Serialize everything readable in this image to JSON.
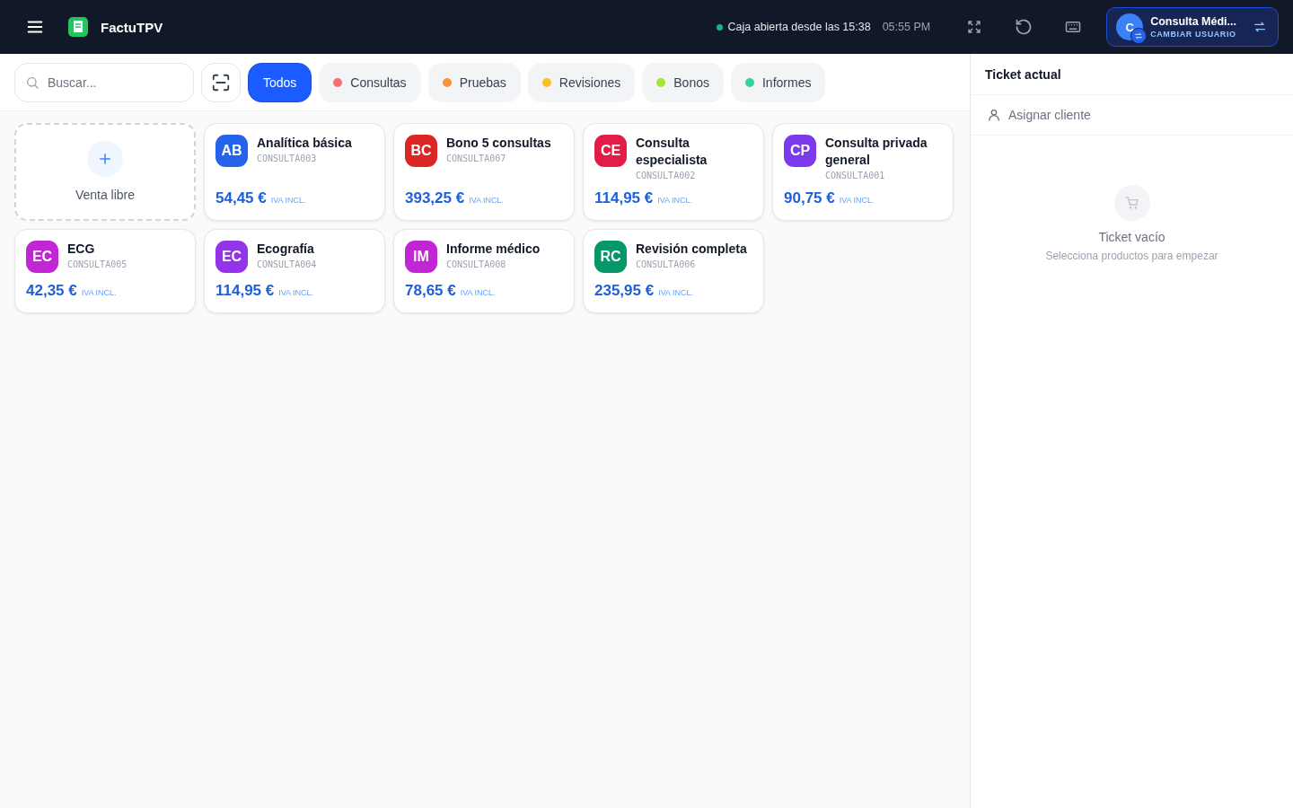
{
  "topbar": {
    "app_name": "FactuTPV",
    "status": {
      "text": "Caja abierta desde las 15:38",
      "color": "#10b981"
    },
    "time": "05:55 PM",
    "user": {
      "initial": "C",
      "name": "Consulta Médi...",
      "action": "CAMBIAR USUARIO"
    }
  },
  "search": {
    "placeholder": "Buscar..."
  },
  "categories": [
    {
      "label": "Todos",
      "selected": true
    },
    {
      "label": "Consultas",
      "selected": false,
      "color": "#f87171"
    },
    {
      "label": "Pruebas",
      "selected": false,
      "color": "#fb923c"
    },
    {
      "label": "Revisiones",
      "selected": false,
      "color": "#fbbf24"
    },
    {
      "label": "Bonos",
      "selected": false,
      "color": "#a3e635"
    },
    {
      "label": "Informes",
      "selected": false,
      "color": "#34d399"
    }
  ],
  "free_sale": {
    "label": "Venta libre"
  },
  "products": [
    {
      "initials": "AB",
      "color": "#2563eb",
      "name": "Analítica básica",
      "code": "CONSULTA003",
      "price": "54,45 €",
      "tax": "IVA INCL."
    },
    {
      "initials": "BC",
      "color": "#dc2626",
      "name": "Bono 5 consultas",
      "code": "CONSULTA007",
      "price": "393,25 €",
      "tax": "IVA INCL."
    },
    {
      "initials": "CE",
      "color": "#e11d48",
      "name": "Consulta especialista",
      "code": "CONSULTA002",
      "price": "114,95 €",
      "tax": "IVA INCL."
    },
    {
      "initials": "CP",
      "color": "#7c3aed",
      "name": "Consulta privada general",
      "code": "CONSULTA001",
      "price": "90,75 €",
      "tax": "IVA INCL."
    },
    {
      "initials": "EC",
      "color": "#c026d3",
      "name": "ECG",
      "code": "CONSULTA005",
      "price": "42,35 €",
      "tax": "IVA INCL."
    },
    {
      "initials": "EC",
      "color": "#9333ea",
      "name": "Ecografía",
      "code": "CONSULTA004",
      "price": "114,95 €",
      "tax": "IVA INCL."
    },
    {
      "initials": "IM",
      "color": "#c026d3",
      "name": "Informe médico",
      "code": "CONSULTA008",
      "price": "78,65 €",
      "tax": "IVA INCL."
    },
    {
      "initials": "RC",
      "color": "#059669",
      "name": "Revisión completa",
      "code": "CONSULTA006",
      "price": "235,95 €",
      "tax": "IVA INCL."
    }
  ],
  "ticket": {
    "title": "Ticket actual",
    "assign_client": "Asignar cliente",
    "empty_title": "Ticket vacío",
    "empty_hint": "Selecciona productos para empezar"
  }
}
